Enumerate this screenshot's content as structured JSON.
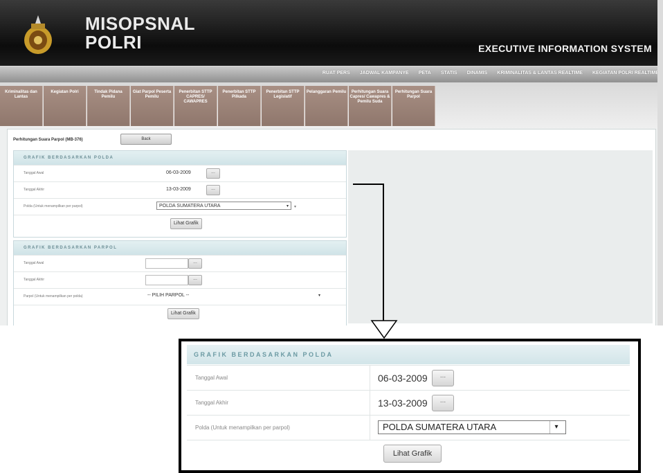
{
  "header": {
    "brand_line1": "MISOPSNAL",
    "brand_line2": "POLRI",
    "system_title": "EXECUTIVE INFORMATION SYSTEM"
  },
  "top_nav": [
    "RUAT PERS",
    "JADWAL KAMPANYE",
    "PETA",
    "STATIS",
    "DINAMIS",
    "KRIMINALITAS & LANTAS REALTIME",
    "KEGIATAN POLRI REALTIME"
  ],
  "sub_nav": [
    "Kriminalitas dan Lantas",
    "Kegiatan Polri",
    "Tindak Pidana Pemilu",
    "Giat Parpol Peserta Pemilu",
    "Penerbitan STTP CAPRES/ CAWAPRES",
    "Penerbitan STTP Pilkada",
    "Penerbitan STTP Legislatif",
    "Pelanggaran Pemilu",
    "Perhitungan Suara Capres/ Cawapres & Pemilu Suda",
    "Perhitungan Suara Parpol"
  ],
  "breadcrumb": "Perhitungan Suara Parpol (MB-376)",
  "back_label": "Back",
  "polda_section": {
    "title": "GRAFIK BERDASARKAN POLDA",
    "start_label": "Tanggal Awal",
    "start_value": "06-03-2009",
    "end_label": "Tanggal Akhir",
    "end_value": "13-03-2009",
    "polda_label": "Polda (Untuk menampilkan per parpol)",
    "polda_value": "POLDA SUMATERA UTARA",
    "button": "Lihat Grafik",
    "date_btn": "..."
  },
  "parpol_section": {
    "title": "GRAFIK BERDASARKAN PARPOL",
    "start_label": "Tanggal Awal",
    "end_label": "Tanggal Akhir",
    "parpol_label": "Parpol (Untuk menampilkan per polda)",
    "parpol_value": "-- PILIH PARPOL --",
    "button": "Lihat Grafik",
    "date_btn": "..."
  },
  "zoom": {
    "title": "GRAFIK BERDASARKAN POLDA",
    "start_label": "Tanggal Awal",
    "start_value": "06-03-2009",
    "end_label": "Tanggal Akhir",
    "end_value": "13-03-2009",
    "polda_label": "Polda (Untuk menampilkan per parpol)",
    "polda_value": "POLDA SUMATERA UTARA",
    "button": "Lihat Grafik",
    "date_btn": "..."
  },
  "icons": {
    "dropdown": "▾",
    "logo": "police-emblem-icon"
  }
}
